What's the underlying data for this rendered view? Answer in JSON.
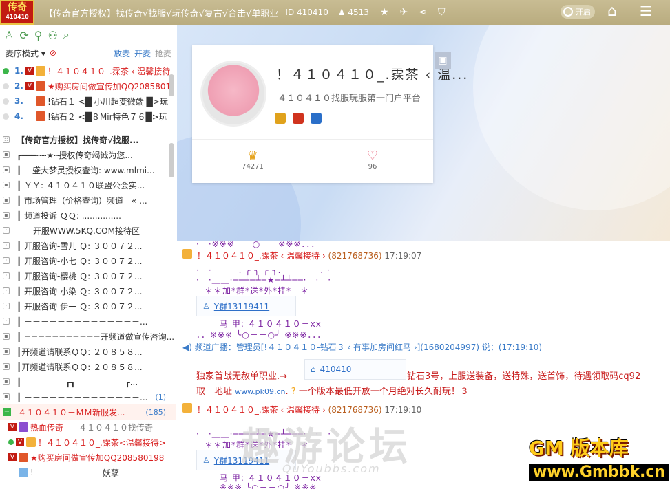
{
  "topbar": {
    "logo_main": "传奇",
    "logo_sub": "410410",
    "title": "【传奇官方授权】找传奇√找服√玩传奇√复古√合击√单职业",
    "room_id": "ID 410410",
    "online": "4513",
    "toggle_label": "开启"
  },
  "left": {
    "mode": "麦序模式",
    "tabs": [
      "放麦",
      "开麦",
      "抢麦"
    ],
    "queue": [
      {
        "num": "1.",
        "text": "！４１０４１０_.霂茶 ‹ 温馨接待",
        "red": true,
        "on": true
      },
      {
        "num": "2.",
        "text": "★购买房间做宣传加QQ2085801",
        "red": true,
        "on": false
      },
      {
        "num": "3.",
        "text": "!钻石１ <█ 小川超变微端 █>玩",
        "red": false,
        "on": false
      },
      {
        "num": "4.",
        "text": "!钻石２ <█８Mir特色７６█>玩",
        "red": false,
        "on": false
      }
    ],
    "channels": [
      {
        "text": "【传奇官方授权】找传奇√找服...",
        "bold": true
      },
      {
        "text": "┏━━━┅┅★┅授权传奇竭诚为您..."
      },
      {
        "text": "┃　 盛大梦灵授权查询: www.mlmi..."
      },
      {
        "text": "┃ ＹＹ: ４１０４１０联盟公会实..."
      },
      {
        "text": "┃ 市场管理（价格查询）频道　« ..."
      },
      {
        "text": "┃ 频道投诉 ＱＱ:  ..............."
      },
      {
        "text": "　　开服WWW.5KQ.COM接待区"
      },
      {
        "text": "┃ 开服咨询-雪儿 Ｑ: ３００７２..."
      },
      {
        "text": "┃ 开服咨询-小七 Ｑ: ３００７２..."
      },
      {
        "text": "┃ 开服咨询-樱桃 Ｑ: ３００７２..."
      },
      {
        "text": "┃ 开服咨询-小染 Ｑ: ３００７２..."
      },
      {
        "text": "┃ 开服咨询-伊一 Ｑ: ３００７２..."
      },
      {
        "text": "┃ －－－－－－－－－－－－－－..."
      },
      {
        "text": "┃ ===========开频道做宣传咨询..."
      },
      {
        "text": "┃开频道请联系ＱＱ: ２０８５８..."
      },
      {
        "text": "┃开频道请联系ＱＱ: ２０８５８..."
      },
      {
        "text": "┃ 　　　　　┏┓　　　　　　┏..."
      },
      {
        "text": "┃ －－－－－－－－－－－－－－...",
        "count": "(1)"
      }
    ],
    "current_channel": {
      "text": "４１０４１０－ＭＭ新服发...",
      "count": "(185)"
    },
    "members": [
      {
        "text": "热血传奇",
        "extra": "４１０４１０找传奇"
      },
      {
        "text": "！４１０４１０_.霂茶<温馨接待>"
      },
      {
        "text": "★购买房间做宣传加QQ208580198"
      },
      {
        "text": "!",
        "extra": "妖孽"
      }
    ]
  },
  "card": {
    "title": "！４１０４１０_.霂茶 ‹ 温...",
    "subtitle": "４１０４１０找服玩服第一门户平台",
    "stat1": "74271",
    "stat2": "96"
  },
  "chat": {
    "msg1_name": "！４１０４１０_.霂茶 ‹ 温馨接待 ›",
    "msg1_qid": "(821768736)",
    "msg1_time": "17:19:07",
    "art1": "·　·＿＿＿. ╭ ╮ ╭ ╮. ＿＿＿＿. ·",
    "art2": "·　·＿＿·══╧═┴═★═┴╧══·　·　·",
    "art3": "＊＊加*群*送*外*挂*　＊",
    "link1": "Y群13119411",
    "art4": "马 甲: ４１０４１０－xx",
    "art5": "．．※※※ ╰○－－○╯ ※※※．．．",
    "sys": "频道广播：管理员[!４１０４１０-钻石３ ‹ 有事加房间红马 ›](1680204997) 说：(17:19:10)",
    "ad1": "独家首战无赦单职业.→",
    "ad_link": "410410",
    "ad2": "钻石3号，上服送装备，送特殊，送首饰，待遇领取码cq92",
    "ad3": "取　地址",
    "ad_url": "www.pk09.cn",
    "ad4": "一个版本最低开放一个月绝对长久耐玩！３",
    "msg2_name": "！４１０４１０_.霂茶 ‹ 温馨接待 ›",
    "msg2_qid": "(821768736)",
    "msg2_time": "17:19:10",
    "art6": "·　·＿＿·══╧═┴═★═┴╧══·　·　·",
    "art7": "＊＊加*群*送*外*挂*　＊",
    "link2": "Y群13119411",
    "art8": "马 甲: ４１０４１０－xx",
    "art9": "※※※ ╰○－－○╯ ※※※"
  },
  "watermark": {
    "cn": "趣游论坛",
    "en": "QuYoubbs.com"
  },
  "gmbbk": {
    "line1": "版本库",
    "line2": "www.Gmbbk.cn"
  }
}
